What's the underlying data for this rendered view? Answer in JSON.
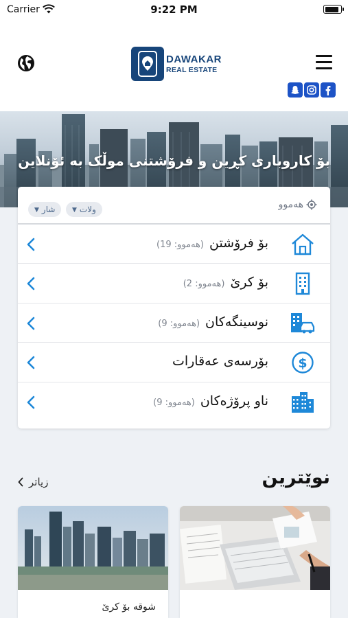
{
  "status_bar": {
    "carrier": "Carrier",
    "time": "9:22 PM",
    "battery_level": 0.9
  },
  "header": {
    "logo_line1": "DAWAKAR",
    "logo_line2": "REAL ESTATE",
    "icons": {
      "language": "globe-icon",
      "menu": "hamburger-menu-icon"
    },
    "social": [
      {
        "name": "snapchat-icon",
        "color": "#1d53c6"
      },
      {
        "name": "instagram-icon",
        "color": "#1d53c6"
      },
      {
        "name": "facebook-icon",
        "color": "#1d53c6"
      }
    ]
  },
  "hero": {
    "title": "بۆ کاروباری کڕین و فرۆشتنی موڵک بە ئۆنلاین"
  },
  "filters": {
    "all_label": "هەموو",
    "all_icon": "location-target-icon",
    "chips": [
      {
        "label": "ولات"
      },
      {
        "label": "شار"
      }
    ]
  },
  "categories": [
    {
      "label": "بۆ فرۆشتن",
      "count": "(هەموو: 19)",
      "icon": "house-icon"
    },
    {
      "label": "بۆ کرێ",
      "count": "(هەموو: 2)",
      "icon": "apartment-building-icon"
    },
    {
      "label": "نوسینگەکان",
      "count": "(هەموو: 9)",
      "icon": "office-car-icon"
    },
    {
      "label": "بۆرسەی عەقارات",
      "count": "",
      "icon": "dollar-circle-icon"
    },
    {
      "label": "ناو پرۆژەکان",
      "count": "(هەموو: 9)",
      "icon": "city-buildings-icon"
    }
  ],
  "newest": {
    "title": "نوێترین",
    "more_label": "زیاتر",
    "listings": [
      {
        "title": "",
        "image": "office-desk-laptop-photo"
      },
      {
        "title": "شوقە بۆ کرێ",
        "image": "city-skyline-photo"
      }
    ]
  },
  "colors": {
    "accent": "#1e88d8",
    "brand": "#17457a",
    "chip_bg": "#e7eaef"
  }
}
